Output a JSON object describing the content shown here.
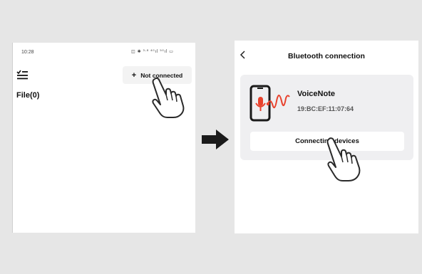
{
  "left_screen": {
    "status_time": "10:28",
    "status_icons": "◫ ✱ ³·⁸ ⁴ᴳıl ⁵ᴳıl ▭",
    "menu_icon": "checklist-menu-icon",
    "add_button": {
      "plus": "+",
      "label": "Not connected"
    },
    "file_count": "File(0)"
  },
  "arrow": "right-arrow-icon",
  "right_screen": {
    "back_icon": "chevron-left-icon",
    "title": "Bluetooth connection",
    "device": {
      "icon": "phone-microphone-icon",
      "name": "VoiceNote",
      "mac": "19:BC:EF:11:07:64"
    },
    "connect_button": "Connecting devices"
  },
  "hand_icon": "tap-hand-icon",
  "colors": {
    "background": "#e6e6e6",
    "panel": "#ffffff",
    "card": "#efeff1",
    "accent_red": "#e8412c",
    "text": "#111111"
  }
}
